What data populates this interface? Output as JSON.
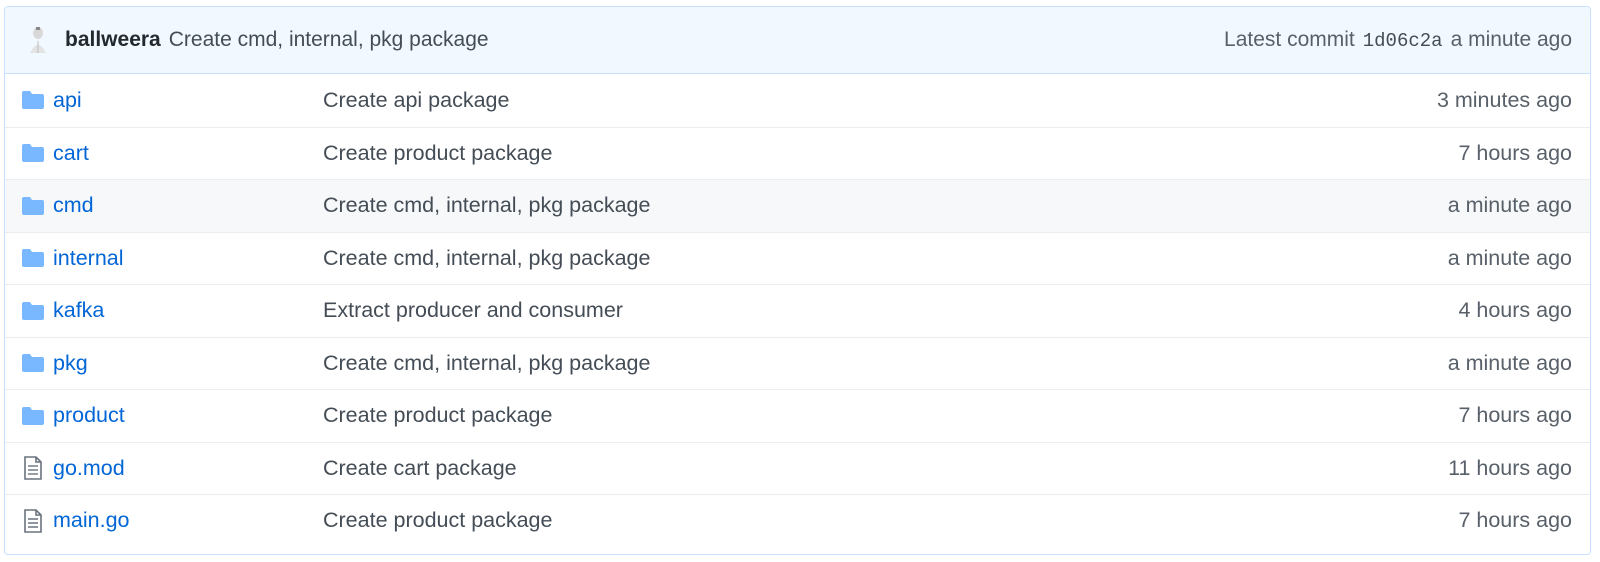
{
  "latest_commit": {
    "author": "ballweera",
    "message": "Create cmd, internal, pkg package",
    "label": "Latest commit",
    "sha": "1d06c2a",
    "age": "a minute ago"
  },
  "files": [
    {
      "name": "api",
      "type": "folder",
      "message": "Create api package",
      "age": "3 minutes ago"
    },
    {
      "name": "cart",
      "type": "folder",
      "message": "Create product package",
      "age": "7 hours ago"
    },
    {
      "name": "cmd",
      "type": "folder",
      "message": "Create cmd, internal, pkg package",
      "age": "a minute ago"
    },
    {
      "name": "internal",
      "type": "folder",
      "message": "Create cmd, internal, pkg package",
      "age": "a minute ago"
    },
    {
      "name": "kafka",
      "type": "folder",
      "message": "Extract producer and consumer",
      "age": "4 hours ago"
    },
    {
      "name": "pkg",
      "type": "folder",
      "message": "Create cmd, internal, pkg package",
      "age": "a minute ago"
    },
    {
      "name": "product",
      "type": "folder",
      "message": "Create product package",
      "age": "7 hours ago"
    },
    {
      "name": "go.mod",
      "type": "file",
      "message": "Create cart package",
      "age": "11 hours ago"
    },
    {
      "name": "main.go",
      "type": "file",
      "message": "Create product package",
      "age": "7 hours ago"
    }
  ],
  "colors": {
    "folder_icon": "#79b8ff",
    "link": "#0366d6",
    "header_bg": "#f1f8ff"
  }
}
